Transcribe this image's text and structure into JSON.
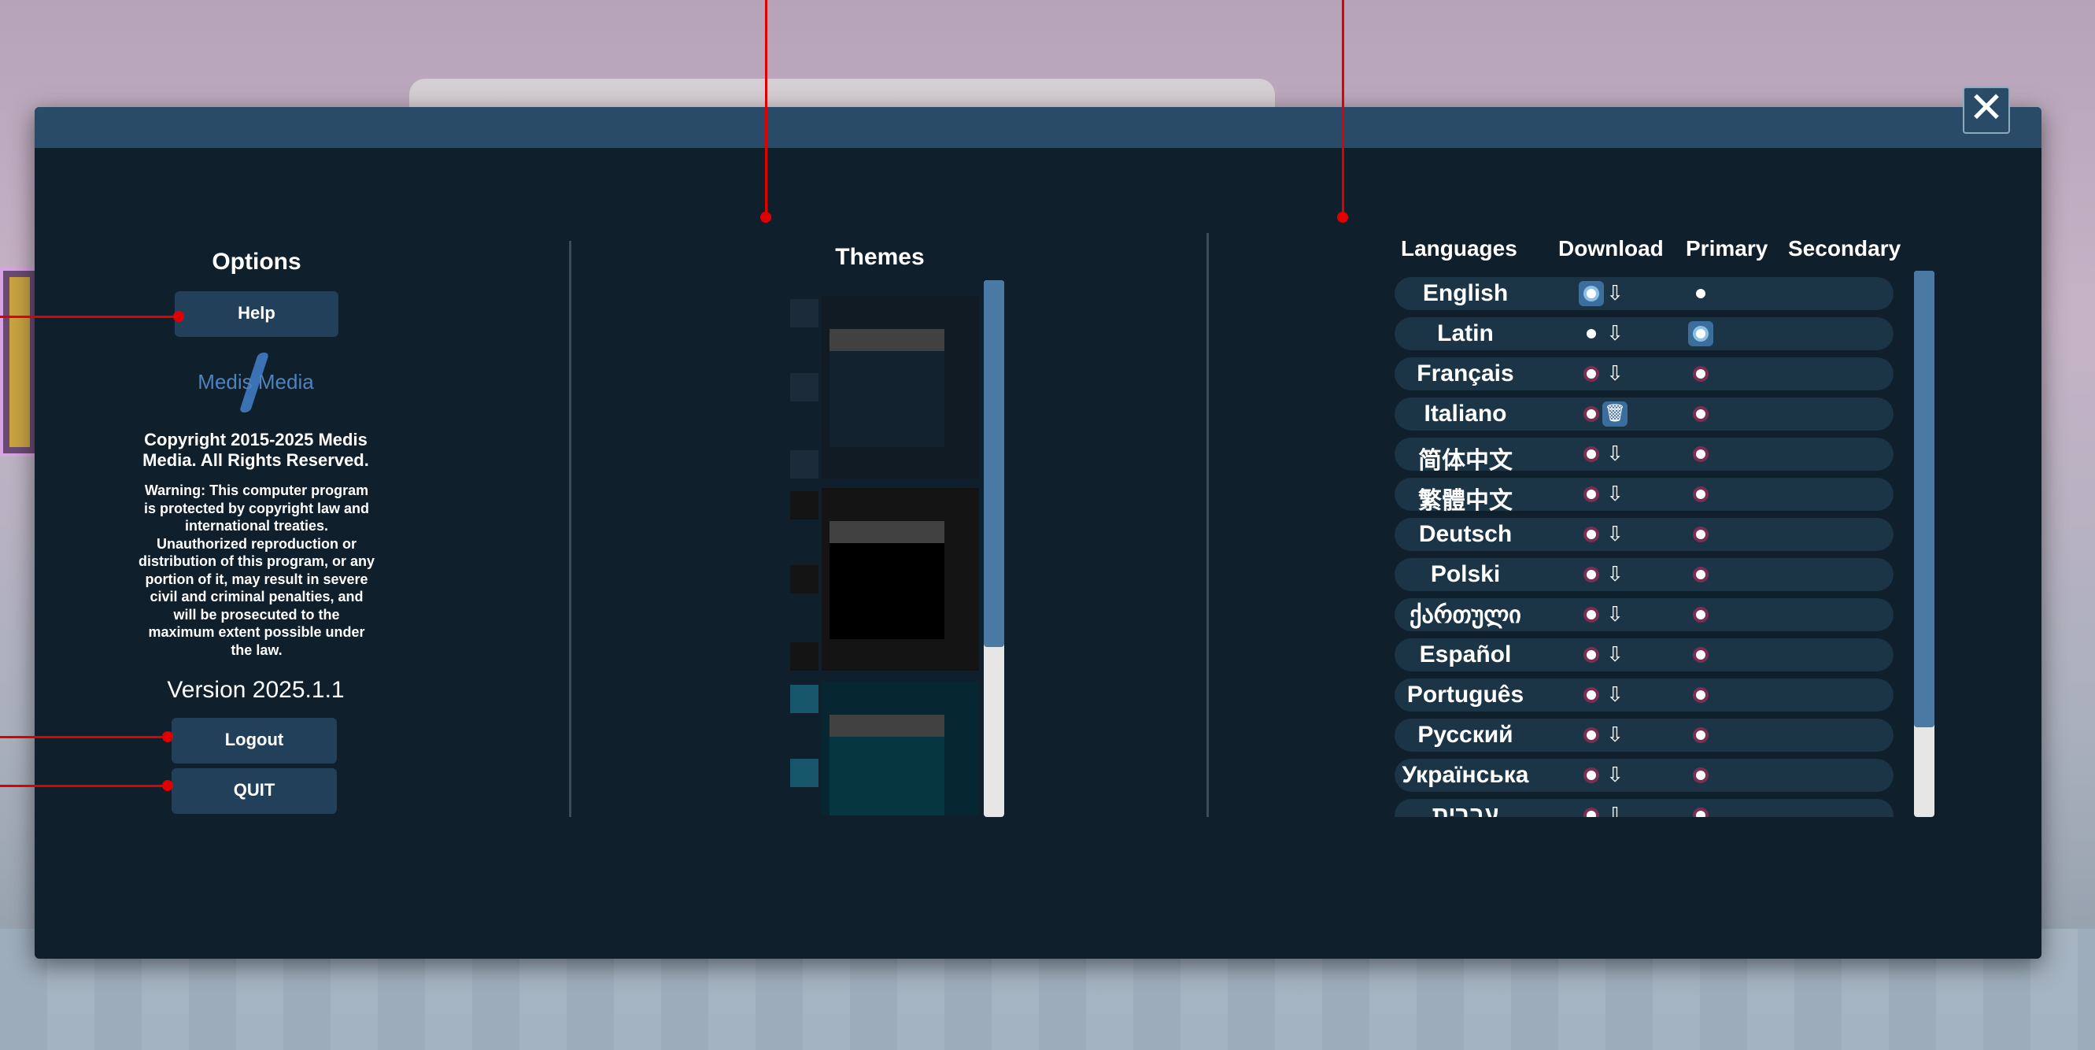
{
  "window": {
    "close_glyph": "✕"
  },
  "options": {
    "title": "Options",
    "help_label": "Help",
    "logo_text": "Medis Media",
    "copyright": "Copyright 2015-2025 Medis Media. All Rights Reserved.",
    "warning": "Warning: This computer program is protected by copyright law and international treaties. Unauthorized reproduction or distribution of this program, or any  portion of it, may result in severe civil and criminal  penalties, and will be prosecuted to the maximum extent possible under the law.",
    "version": "Version 2025.1.1",
    "logout_label": "Logout",
    "quit_label": "QUIT"
  },
  "themes": {
    "title": "Themes",
    "items": [
      {
        "name": "dark-blue-theme",
        "color": "#13222f"
      },
      {
        "name": "black-theme",
        "color": "#0a0a0a"
      },
      {
        "name": "teal-theme",
        "color": "#063640"
      }
    ]
  },
  "languages": {
    "headers": {
      "language": "Languages",
      "download": "Download",
      "primary": "Primary",
      "secondary": "Secondary"
    },
    "items": [
      {
        "name": "English",
        "download_icon": "cloud-download-icon",
        "primary": true,
        "secondary": false
      },
      {
        "name": "Latin",
        "download_icon": "cloud-download-icon",
        "primary": false,
        "secondary": true
      },
      {
        "name": "Français",
        "download_icon": "cloud-download-icon",
        "primary": false,
        "secondary": false
      },
      {
        "name": "Italiano",
        "download_icon": "trash-icon",
        "primary": false,
        "secondary": false
      },
      {
        "name": "简体中文",
        "download_icon": "cloud-download-icon",
        "primary": false,
        "secondary": false
      },
      {
        "name": "繁體中文",
        "download_icon": "cloud-download-icon",
        "primary": false,
        "secondary": false
      },
      {
        "name": "Deutsch",
        "download_icon": "cloud-download-icon",
        "primary": false,
        "secondary": false
      },
      {
        "name": "Polski",
        "download_icon": "cloud-download-icon",
        "primary": false,
        "secondary": false
      },
      {
        "name": "ქართული",
        "download_icon": "cloud-download-icon",
        "primary": false,
        "secondary": false
      },
      {
        "name": "Español",
        "download_icon": "cloud-download-icon",
        "primary": false,
        "secondary": false
      },
      {
        "name": "Português",
        "download_icon": "cloud-download-icon",
        "primary": false,
        "secondary": false
      },
      {
        "name": "Русский",
        "download_icon": "cloud-download-icon",
        "primary": false,
        "secondary": false
      },
      {
        "name": "Українська",
        "download_icon": "cloud-download-icon",
        "primary": false,
        "secondary": false
      },
      {
        "name": "עברית",
        "download_icon": "cloud-download-icon",
        "primary": false,
        "secondary": false
      }
    ]
  },
  "colors": {
    "panel_bg": "#0f1f2b",
    "header_bar": "#2a4b67",
    "button_bg": "#23405a",
    "selected_radio": "#3b6e9c",
    "annotation": "#e00000"
  }
}
